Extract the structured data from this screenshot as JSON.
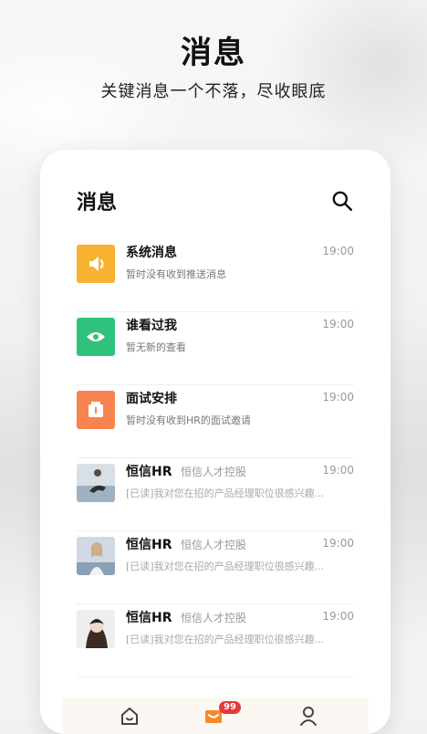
{
  "promo": {
    "headline": "消息",
    "subheadline": "关键消息一个不落，尽收眼底"
  },
  "screen": {
    "title": "消息",
    "items": [
      {
        "name": "系统消息",
        "company": "",
        "time": "19:00",
        "preview": "暂时没有收到推送消息",
        "icon": "speaker-icon"
      },
      {
        "name": "谁看过我",
        "company": "",
        "time": "19:00",
        "preview": "暂无新的查看",
        "icon": "eye-icon"
      },
      {
        "name": "面试安排",
        "company": "",
        "time": "19:00",
        "preview": "暂时没有收到HR的面试邀请",
        "icon": "calendar-icon"
      },
      {
        "name": "恒信HR",
        "company": "恒信人才控股",
        "time": "19:00",
        "preview": "[已读]我对您在招的产品经理职位很感兴趣...",
        "icon": "avatar-photo"
      },
      {
        "name": "恒信HR",
        "company": "恒信人才控股",
        "time": "19:00",
        "preview": "[已读]我对您在招的产品经理职位很感兴趣...",
        "icon": "avatar-photo"
      },
      {
        "name": "恒信HR",
        "company": "恒信人才控股",
        "time": "19:00",
        "preview": "[已读]我对您在招的产品经理职位很感兴趣...",
        "icon": "avatar-photo"
      }
    ],
    "tabbar": {
      "badge": "99"
    }
  }
}
